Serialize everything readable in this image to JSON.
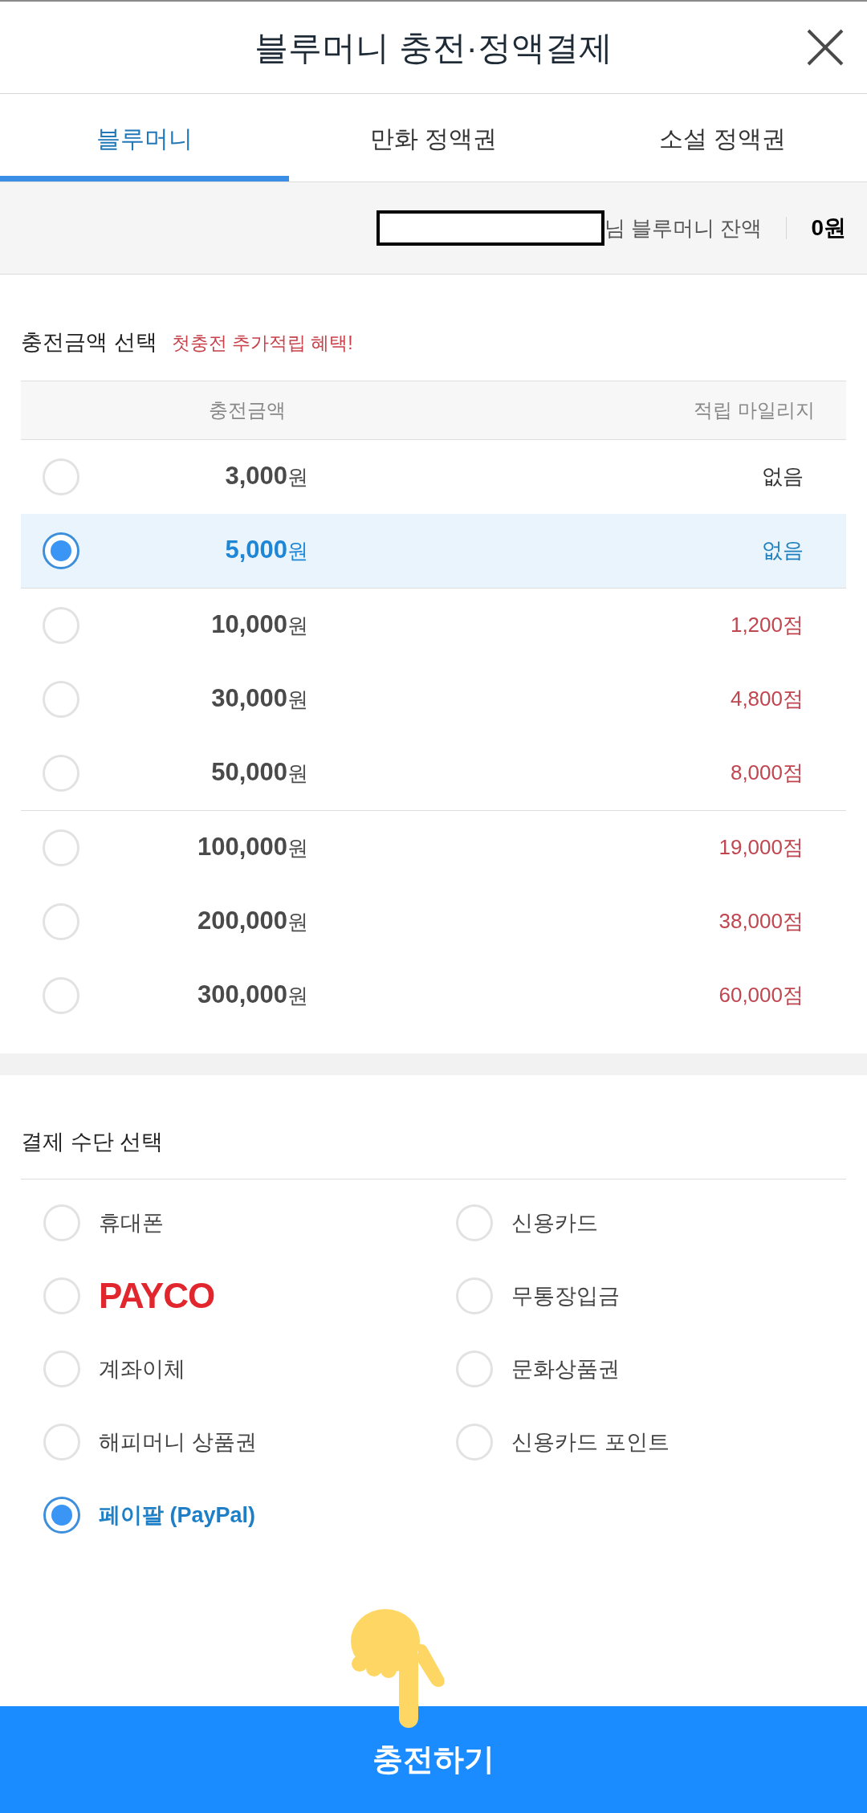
{
  "header": {
    "title": "블루머니 충전·정액결제"
  },
  "tabs": [
    {
      "label": "블루머니",
      "selected": true
    },
    {
      "label": "만화 정액권",
      "selected": false
    },
    {
      "label": "소설 정액권",
      "selected": false
    }
  ],
  "balance": {
    "label": "님 블루머니 잔액",
    "amount": "0원"
  },
  "amount_section": {
    "title": "충전금액 선택",
    "promo": "첫충전 추가적립 혜택!",
    "columns": [
      "충전금액",
      "적립 마일리지"
    ],
    "groups": [
      {
        "rows": [
          {
            "amount": "**3,000**원",
            "mileage": "없음",
            "kind": "none",
            "selected": false
          },
          {
            "amount": "**5,000**원",
            "mileage": "없음",
            "kind": "none",
            "selected": true
          }
        ]
      },
      {
        "rows": [
          {
            "amount": "**10,000**원",
            "mileage": "1,200점",
            "kind": "points",
            "selected": false
          },
          {
            "amount": "**30,000**원",
            "mileage": "4,800점",
            "kind": "points",
            "selected": false
          },
          {
            "amount": "**50,000**원",
            "mileage": "8,000점",
            "kind": "points",
            "selected": false
          }
        ]
      },
      {
        "rows": [
          {
            "amount": "**100,000**원",
            "mileage": "19,000점",
            "kind": "points",
            "selected": false
          },
          {
            "amount": "**200,000**원",
            "mileage": "38,000점",
            "kind": "points",
            "selected": false
          },
          {
            "amount": "**300,000**원",
            "mileage": "60,000점",
            "kind": "points",
            "selected": false
          }
        ]
      }
    ]
  },
  "payment_section": {
    "title": "결제 수단 선택",
    "methods": [
      {
        "label": "휴대폰",
        "kind": "text",
        "selected": false
      },
      {
        "label": "신용카드",
        "kind": "text",
        "selected": false
      },
      {
        "label": "PAYCO",
        "kind": "logo",
        "selected": false
      },
      {
        "label": "무통장입금",
        "kind": "text",
        "selected": false
      },
      {
        "label": "계좌이체",
        "kind": "text",
        "selected": false
      },
      {
        "label": "문화상품권",
        "kind": "text",
        "selected": false
      },
      {
        "label": "해피머니 상품권",
        "kind": "text",
        "selected": false
      },
      {
        "label": "신용카드 포인트",
        "kind": "text",
        "selected": false
      },
      {
        "label": "페이팔 (PayPal)",
        "kind": "text",
        "selected": true
      }
    ]
  },
  "submit_button": {
    "label": "충전하기"
  }
}
